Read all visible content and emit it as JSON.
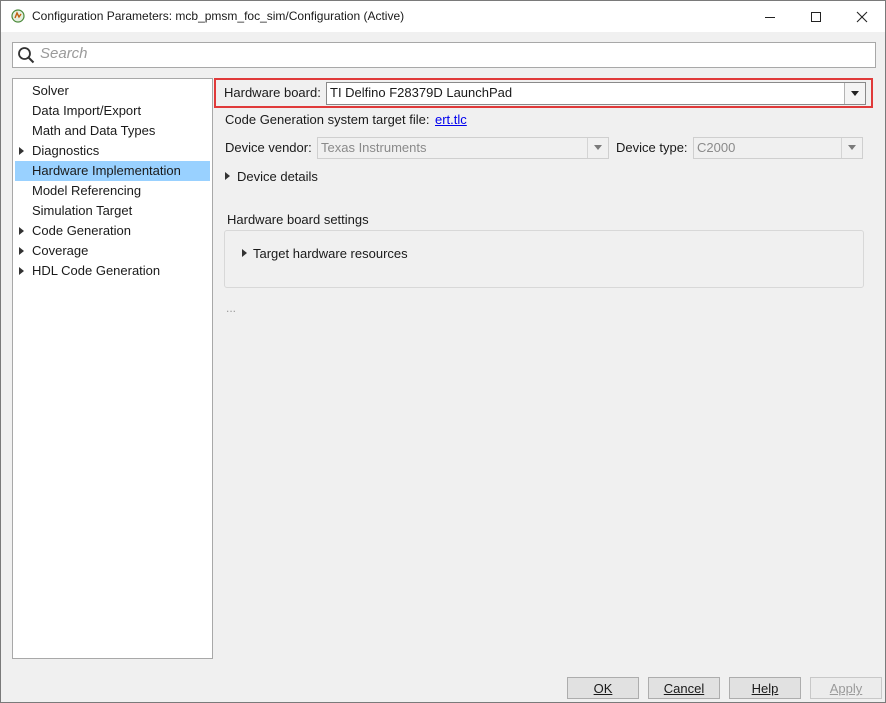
{
  "window": {
    "title": "Configuration Parameters: mcb_pmsm_foc_sim/Configuration (Active)"
  },
  "search": {
    "placeholder": "Search"
  },
  "tree": {
    "items": [
      {
        "label": "Solver",
        "expandable": false,
        "selected": false
      },
      {
        "label": "Data Import/Export",
        "expandable": false,
        "selected": false
      },
      {
        "label": "Math and Data Types",
        "expandable": false,
        "selected": false
      },
      {
        "label": "Diagnostics",
        "expandable": true,
        "selected": false
      },
      {
        "label": "Hardware Implementation",
        "expandable": false,
        "selected": true
      },
      {
        "label": "Model Referencing",
        "expandable": false,
        "selected": false
      },
      {
        "label": "Simulation Target",
        "expandable": false,
        "selected": false
      },
      {
        "label": "Code Generation",
        "expandable": true,
        "selected": false
      },
      {
        "label": "Coverage",
        "expandable": true,
        "selected": false
      },
      {
        "label": "HDL Code Generation",
        "expandable": true,
        "selected": false
      }
    ]
  },
  "main": {
    "hardware_board_label": "Hardware board:",
    "hardware_board_value": "TI Delfino F28379D LaunchPad",
    "codegen_label": "Code Generation system target file:",
    "codegen_link": "ert.tlc",
    "device_vendor_label": "Device vendor:",
    "device_vendor_value": "Texas Instruments",
    "device_type_label": "Device type:",
    "device_type_value": "C2000",
    "device_details_label": "Device details",
    "board_settings_label": "Hardware board settings",
    "target_resources_label": "Target hardware resources",
    "ellipsis": "..."
  },
  "buttons": {
    "ok": "OK",
    "cancel": "Cancel",
    "help": "Help",
    "apply": "Apply"
  },
  "colors": {
    "selection": "#99d1ff",
    "highlight_border": "#e03a3a",
    "link": "#0000ee"
  }
}
